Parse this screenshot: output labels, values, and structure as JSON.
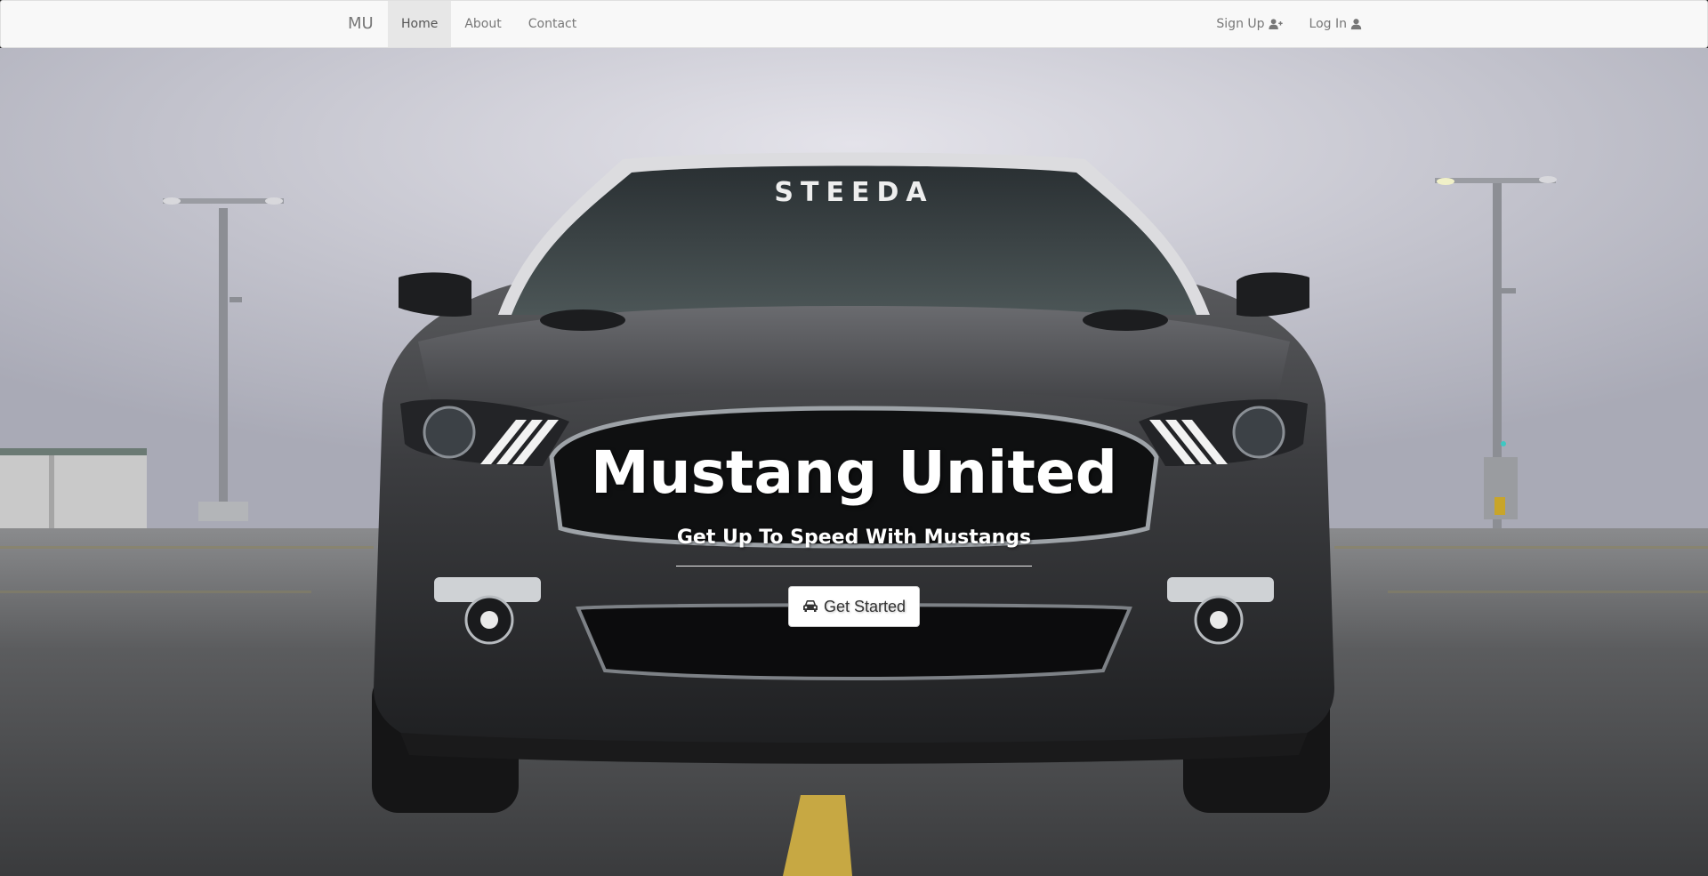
{
  "navbar": {
    "brand": "MU",
    "links": [
      {
        "label": "Home",
        "active": true
      },
      {
        "label": "About",
        "active": false
      },
      {
        "label": "Contact",
        "active": false
      }
    ],
    "right_links": [
      {
        "label": "Sign Up",
        "icon": "user-plus-icon"
      },
      {
        "label": "Log In",
        "icon": "user-icon"
      }
    ]
  },
  "hero": {
    "title": "Mustang United",
    "subtitle": "Get Up To Speed With Mustangs",
    "cta_label": "Get Started",
    "cta_icon": "car-icon",
    "background_image": "Dark grey Ford Mustang front view on parking deck with light poles",
    "windshield_banner": "STEEDA"
  },
  "colors": {
    "navbar_bg": "#f8f8f8",
    "navbar_active_bg": "#e7e7e7",
    "navbar_text": "#777777",
    "hero_text": "#ffffff",
    "button_bg": "#ffffff",
    "button_text": "#333333"
  }
}
